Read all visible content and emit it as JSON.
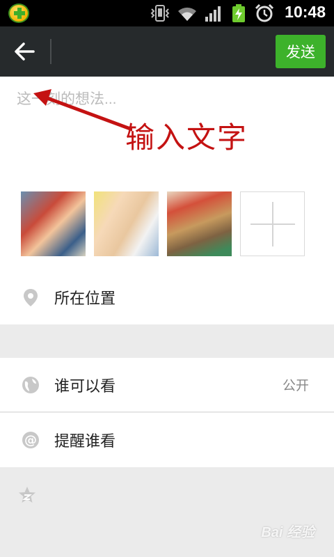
{
  "status_bar": {
    "time": "10:48",
    "icons": [
      "app-shield-icon",
      "vibrate-icon",
      "wifi-icon",
      "signal-icon",
      "battery-charging-icon",
      "alarm-icon"
    ]
  },
  "toolbar": {
    "back_icon": "arrow-left-icon",
    "send_label": "发送"
  },
  "compose": {
    "placeholder": "这一刻的想法...",
    "annotation": "输入文字"
  },
  "photos": {
    "count": 3,
    "add_icon": "plus-icon"
  },
  "options": {
    "location_label": "所在位置",
    "visibility_label": "谁可以看",
    "visibility_value": "公开",
    "remind_label": "提醒谁看"
  },
  "watermark": "Bai 经验",
  "colors": {
    "accent_green": "#3db22b",
    "toolbar_bg": "#262a2c",
    "annotation_red": "#c41212"
  }
}
